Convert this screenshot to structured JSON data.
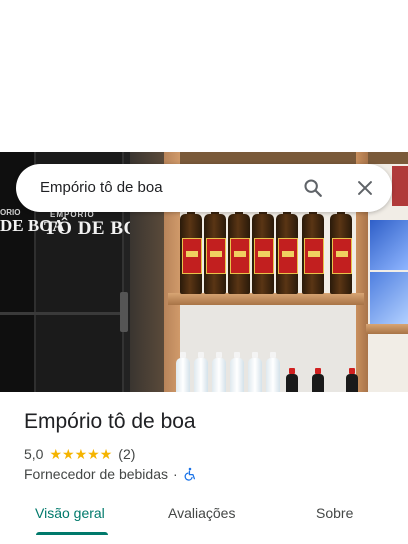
{
  "search": {
    "query": "Empório tô de boa",
    "search_icon": "search-icon",
    "close_icon": "close-icon"
  },
  "photo": {
    "fridge_brand_small": "EMPÓRIO",
    "fridge_brand_large": "TÔ DE BOA",
    "fridge_brand_left_small": "ORIO",
    "fridge_brand_left_large": "DE BOA"
  },
  "place": {
    "name": "Empório tô de boa",
    "rating": "5,0",
    "stars": 5,
    "review_count": "(2)",
    "category": "Fornecedor de bebidas",
    "separator": "·",
    "accessibility_icon": "wheelchair-icon"
  },
  "tabs": [
    {
      "label": "Visão geral",
      "active": true
    },
    {
      "label": "Avaliações",
      "active": false
    },
    {
      "label": "Sobre",
      "active": false
    }
  ],
  "colors": {
    "accent": "#00796b",
    "star": "#f5b400",
    "accessibility": "#1a73e8"
  }
}
